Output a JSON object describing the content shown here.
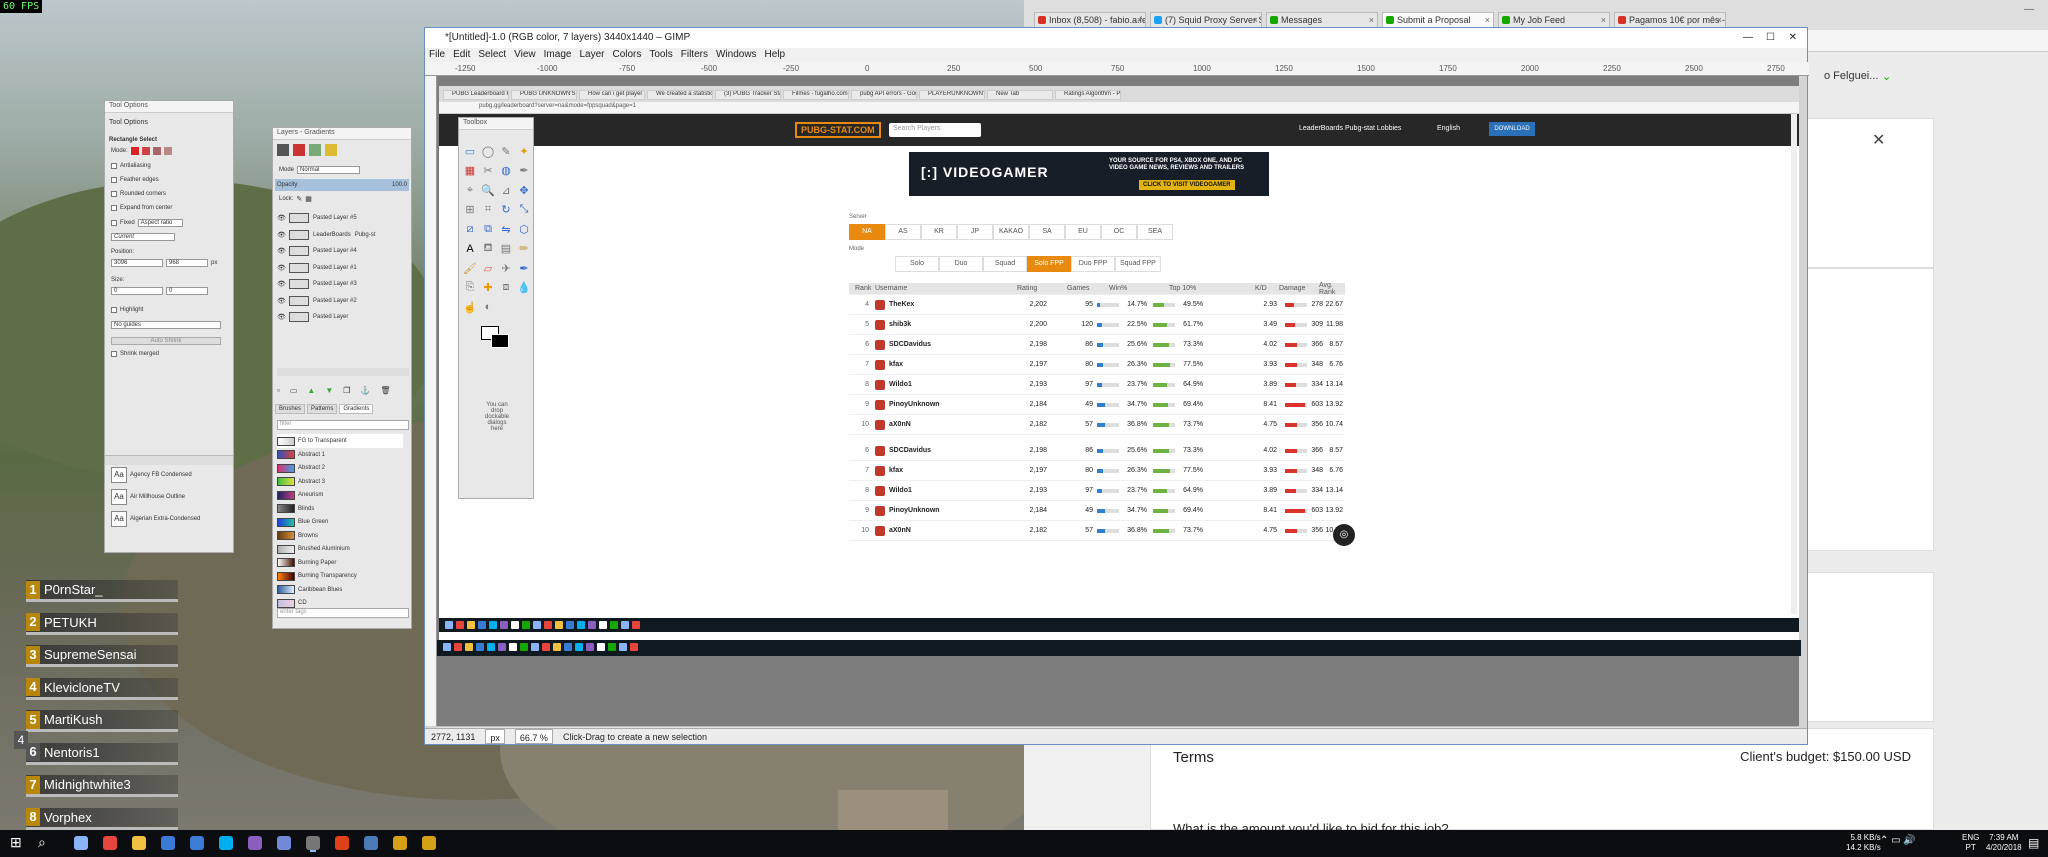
{
  "hud": {
    "fps": "60 FPS"
  },
  "squad": [
    {
      "num": "1",
      "name": "P0rnStar_"
    },
    {
      "num": "2",
      "name": "PETUKH"
    },
    {
      "num": "3",
      "name": "SupremeSensai"
    },
    {
      "num": "4",
      "name": "KlevicloneTV"
    },
    {
      "num": "5",
      "name": "MartiKush"
    },
    {
      "num": "6",
      "name": "Nentoris1"
    },
    {
      "num": "7",
      "name": "Midnightwhite3"
    },
    {
      "num": "8",
      "name": "Vorphex"
    }
  ],
  "squad_side_marker": "4",
  "chrome": {
    "tabs": [
      {
        "label": "Inbox (8,508) - fabio.a.fe",
        "color": "#d93025"
      },
      {
        "label": "(7) Squid Proxy Server Se",
        "color": "#1da1f2"
      },
      {
        "label": "Messages",
        "color": "#14a800"
      },
      {
        "label": "Submit a Proposal",
        "color": "#14a800"
      },
      {
        "label": "My Job Feed",
        "color": "#14a800"
      },
      {
        "label": "Pagamos 10€ por mês - ",
        "color": "#d93025"
      }
    ],
    "user_name": "o Felguei...",
    "terms_title": "Terms",
    "budget": "Client's budget: $150.00 USD",
    "question": "What is the amount you'd like to bid for this job?"
  },
  "gimp": {
    "title": "*[Untitled]-1.0 (RGB color, 7 layers) 3440x1440 – GIMP",
    "menu": [
      "File",
      "Edit",
      "Select",
      "View",
      "Image",
      "Layer",
      "Colors",
      "Tools",
      "Filters",
      "Windows",
      "Help"
    ],
    "ruler_marks": [
      "-1250",
      "-1000",
      "-750",
      "-500",
      "-250",
      "0",
      "250",
      "500",
      "750",
      "1000",
      "1250",
      "1500",
      "1750",
      "2000",
      "2250",
      "2500",
      "2750"
    ],
    "status": {
      "coords": "2772, 1131",
      "unit": "px",
      "zoom": "66.7 %",
      "message": "Click-Drag to create a new selection"
    }
  },
  "tool_options": {
    "title": "Tool Options",
    "tab": "Tool Options",
    "tool_name": "Rectangle Select",
    "mode_label": "Mode:",
    "antialiasing": "Antialiasing",
    "feather": "Feather edges",
    "rounded": "Rounded corners",
    "expand": "Expand from center",
    "fixed": "Fixed",
    "fixed_value": "Aspect ratio",
    "current": "Current",
    "position_label": "Position:",
    "pos_x": "3096",
    "pos_y": "968",
    "unit": "px",
    "size_label": "Size:",
    "size_w": "0",
    "size_h": "0",
    "highlight": "Highlight",
    "guides": "No guides",
    "auto_shrink": "Auto Shrink",
    "shrink_merged": "Shrink merged",
    "fonts": [
      "Agency FB Condensed",
      "Air Millhouse Outline",
      "Algerian Extra-Condensed"
    ]
  },
  "layers": {
    "title": "Layers - Gradients",
    "mode_label": "Mode",
    "mode_value": "Normal",
    "opacity_label": "Opacity",
    "opacity_value": "100.0",
    "lock_label": "Lock:",
    "items": [
      {
        "name": "Pasted Layer #5"
      },
      {
        "name": "LeaderBoards",
        "extra": "Pubg-st"
      },
      {
        "name": "Pasted Layer #4"
      },
      {
        "name": "Pasted Layer #1"
      },
      {
        "name": "Pasted Layer #3"
      },
      {
        "name": "Pasted Layer #2"
      },
      {
        "name": "Pasted Layer"
      }
    ],
    "tabs": [
      "Brushes",
      "Patterns",
      "Gradients"
    ],
    "filter_placeholder": "filter",
    "gradients": [
      {
        "name": "FG to Transparent",
        "c1": "#ffffff",
        "c2": "#cccccc"
      },
      {
        "name": "Abstract 1",
        "c1": "#3050c0",
        "c2": "#e04040"
      },
      {
        "name": "Abstract 2",
        "c1": "#e03070",
        "c2": "#40a0e0"
      },
      {
        "name": "Abstract 3",
        "c1": "#40c040",
        "c2": "#e0e040"
      },
      {
        "name": "Aneurism",
        "c1": "#202060",
        "c2": "#c04080"
      },
      {
        "name": "Blinds",
        "c1": "#888888",
        "c2": "#222222"
      },
      {
        "name": "Blue Green",
        "c1": "#2040e0",
        "c2": "#20c0a0"
      },
      {
        "name": "Browns",
        "c1": "#6a3a10",
        "c2": "#d0903a"
      },
      {
        "name": "Brushed Aluminium",
        "c1": "#b0b0b0",
        "c2": "#eeeeee"
      },
      {
        "name": "Burning Paper",
        "c1": "#ffffff",
        "c2": "#401000"
      },
      {
        "name": "Burning Transparency",
        "c1": "#ff8000",
        "c2": "#400000"
      },
      {
        "name": "Caribbean Blues",
        "c1": "#3060a0",
        "c2": "#e0f0ff"
      },
      {
        "name": "CD",
        "c1": "#c0c0e0",
        "c2": "#f0d0e0"
      }
    ],
    "tag_placeholder": "enter tags"
  },
  "toolbox": {
    "title": "Toolbox",
    "hint": "You can drop dockable dialogs here"
  },
  "inner_browser": {
    "tabs": [
      "PUBG Leaderboard Fra",
      "PUBG UNKNOWN'S B",
      "How can i get player st",
      "We created a statistic",
      "(3) PUBG Tracker Stat",
      "Filmes - fugalho.com",
      "pubg API errors - Goog",
      "PLAYERUNKNOWN'S B",
      "New Tab",
      "Ratings Algorithm - PU"
    ],
    "url": "pubg.gg/leaderboard?server=na&mode=fppsquad&page=1",
    "site": {
      "logo": "PUBG-STAT.COM",
      "search_placeholder": "Search Players",
      "nav": [
        "LeaderBoards",
        "Pubg-stat Lobbies"
      ],
      "lang": "English",
      "cta": "DOWNLOAD"
    },
    "banner": {
      "logo": "[:] VIDEOGAMER",
      "tagline": "YOUR SOURCE FOR PS4, XBOX ONE, AND PC VIDEO GAME NEWS, REVIEWS AND TRAILERS",
      "cta": "CLICK TO VISIT VIDEOGAMER"
    },
    "server_label": "Server",
    "servers": [
      "NA",
      "AS",
      "KR",
      "JP",
      "KAKAO",
      "SA",
      "EU",
      "OC",
      "SEA"
    ],
    "active_server": "NA",
    "mode_label": "Mode",
    "modes": [
      "Solo",
      "Duo",
      "Squad",
      "Solo FPP",
      "Duo FPP",
      "Squad FPP"
    ],
    "active_mode": "Solo FPP",
    "columns": [
      "Rank",
      "Username",
      "Rating",
      "Games",
      "Win%",
      "Top 10%",
      "K/D",
      "Damage",
      "Avg. Rank"
    ],
    "rows": [
      {
        "rank": "4",
        "user": "TheKex",
        "rating": "2,202",
        "games": "95",
        "win": "14.7%",
        "win_v": 14.7,
        "top": "49.5%",
        "top_v": 49.5,
        "kd": "2.93",
        "dmg": "278",
        "dmg_v": 278,
        "avg": "22.67"
      },
      {
        "rank": "5",
        "user": "shib3k",
        "rating": "2,200",
        "games": "120",
        "win": "22.5%",
        "win_v": 22.5,
        "top": "61.7%",
        "top_v": 61.7,
        "kd": "3.49",
        "dmg": "309",
        "dmg_v": 309,
        "avg": "11.98"
      },
      {
        "rank": "6",
        "user": "SDCDavidus",
        "rating": "2,198",
        "games": "86",
        "win": "25.6%",
        "win_v": 25.6,
        "top": "73.3%",
        "top_v": 73.3,
        "kd": "4.02",
        "dmg": "366",
        "dmg_v": 366,
        "avg": "8.57"
      },
      {
        "rank": "7",
        "user": "kfax",
        "rating": "2,197",
        "games": "80",
        "win": "26.3%",
        "win_v": 26.3,
        "top": "77.5%",
        "top_v": 77.5,
        "kd": "3.93",
        "dmg": "348",
        "dmg_v": 348,
        "avg": "6.76"
      },
      {
        "rank": "8",
        "user": "Wildo1",
        "rating": "2,193",
        "games": "97",
        "win": "23.7%",
        "win_v": 23.7,
        "top": "64.9%",
        "top_v": 64.9,
        "kd": "3.89",
        "dmg": "334",
        "dmg_v": 334,
        "avg": "13.14"
      },
      {
        "rank": "9",
        "user": "PinoyUnknown",
        "rating": "2,184",
        "games": "49",
        "win": "34.7%",
        "win_v": 34.7,
        "top": "69.4%",
        "top_v": 69.4,
        "kd": "8.41",
        "dmg": "603",
        "dmg_v": 603,
        "avg": "13.92"
      },
      {
        "rank": "10",
        "user": "aX0nN",
        "rating": "2,182",
        "games": "57",
        "win": "36.8%",
        "win_v": 36.8,
        "top": "73.7%",
        "top_v": 73.7,
        "kd": "4.75",
        "dmg": "356",
        "dmg_v": 356,
        "avg": "10.74"
      },
      {
        "rank": "6",
        "user": "SDCDavidus",
        "rating": "2,198",
        "games": "86",
        "win": "25.6%",
        "win_v": 25.6,
        "top": "73.3%",
        "top_v": 73.3,
        "kd": "4.02",
        "dmg": "366",
        "dmg_v": 366,
        "avg": "8.57"
      },
      {
        "rank": "7",
        "user": "kfax",
        "rating": "2,197",
        "games": "80",
        "win": "26.3%",
        "win_v": 26.3,
        "top": "77.5%",
        "top_v": 77.5,
        "kd": "3.93",
        "dmg": "348",
        "dmg_v": 348,
        "avg": "6.76"
      },
      {
        "rank": "8",
        "user": "Wildo1",
        "rating": "2,193",
        "games": "97",
        "win": "23.7%",
        "win_v": 23.7,
        "top": "64.9%",
        "top_v": 64.9,
        "kd": "3.89",
        "dmg": "334",
        "dmg_v": 334,
        "avg": "13.14"
      },
      {
        "rank": "9",
        "user": "PinoyUnknown",
        "rating": "2,184",
        "games": "49",
        "win": "34.7%",
        "win_v": 34.7,
        "top": "69.4%",
        "top_v": 69.4,
        "kd": "8.41",
        "dmg": "603",
        "dmg_v": 603,
        "avg": "13.92"
      },
      {
        "rank": "10",
        "user": "aX0nN",
        "rating": "2,182",
        "games": "57",
        "win": "36.8%",
        "win_v": 36.8,
        "top": "73.7%",
        "top_v": 73.7,
        "kd": "4.75",
        "dmg": "356",
        "dmg_v": 356,
        "avg": "10.74"
      }
    ]
  },
  "taskbar": {
    "net_up": "5.8 KB/s",
    "net_down": "14.2 KB/s",
    "lang": "ENG",
    "region": "PT",
    "time": "7:39 AM",
    "date": "4/20/2018"
  },
  "colors": {
    "accent": "#e88a10",
    "win_bar": "#2f80d0",
    "top_bar": "#6cb33f",
    "dmg_bar": "#d9342b"
  }
}
